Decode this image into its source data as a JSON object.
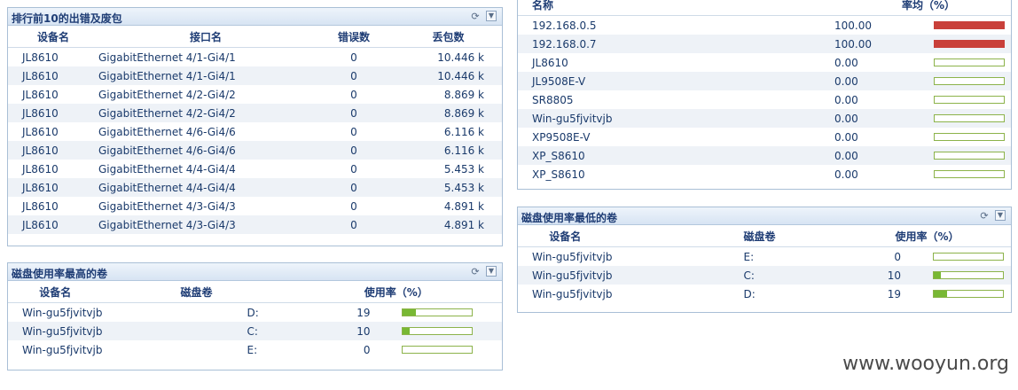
{
  "top_errors": {
    "title": "排行前10的出错及废包",
    "columns": [
      "设备名",
      "接口名",
      "错误数",
      "丢包数"
    ],
    "rows": [
      {
        "device": "JL8610",
        "iface": "GigabitEthernet 4/1-Gi4/1",
        "errors": "0",
        "drops": "10.446 k"
      },
      {
        "device": "JL8610",
        "iface": "GigabitEthernet 4/1-Gi4/1",
        "errors": "0",
        "drops": "10.446 k"
      },
      {
        "device": "JL8610",
        "iface": "GigabitEthernet 4/2-Gi4/2",
        "errors": "0",
        "drops": "8.869 k"
      },
      {
        "device": "JL8610",
        "iface": "GigabitEthernet 4/2-Gi4/2",
        "errors": "0",
        "drops": "8.869 k"
      },
      {
        "device": "JL8610",
        "iface": "GigabitEthernet 4/6-Gi4/6",
        "errors": "0",
        "drops": "6.116 k"
      },
      {
        "device": "JL8610",
        "iface": "GigabitEthernet 4/6-Gi4/6",
        "errors": "0",
        "drops": "6.116 k"
      },
      {
        "device": "JL8610",
        "iface": "GigabitEthernet 4/4-Gi4/4",
        "errors": "0",
        "drops": "5.453 k"
      },
      {
        "device": "JL8610",
        "iface": "GigabitEthernet 4/4-Gi4/4",
        "errors": "0",
        "drops": "5.453 k"
      },
      {
        "device": "JL8610",
        "iface": "GigabitEthernet 4/3-Gi4/3",
        "errors": "0",
        "drops": "4.891 k"
      },
      {
        "device": "JL8610",
        "iface": "GigabitEthernet 4/3-Gi4/3",
        "errors": "0",
        "drops": "4.891 k"
      }
    ]
  },
  "disk_highest": {
    "title": "磁盘使用率最高的卷",
    "columns": [
      "设备名",
      "磁盘卷",
      "使用率（%）"
    ],
    "rows": [
      {
        "device": "Win-gu5fjvitvjb",
        "volume": "D:",
        "usage": "19",
        "pct": 19
      },
      {
        "device": "Win-gu5fjvitvjb",
        "volume": "C:",
        "usage": "10",
        "pct": 10
      },
      {
        "device": "Win-gu5fjvitvjb",
        "volume": "E:",
        "usage": "0",
        "pct": 0
      }
    ]
  },
  "loss_rate": {
    "columns": [
      "名称",
      "率均（%）"
    ],
    "rows": [
      {
        "name": "192.168.0.5",
        "value": "100.00",
        "pct": 100
      },
      {
        "name": "192.168.0.7",
        "value": "100.00",
        "pct": 100
      },
      {
        "name": "JL8610",
        "value": "0.00",
        "pct": 0
      },
      {
        "name": "JL9508E-V",
        "value": "0.00",
        "pct": 0
      },
      {
        "name": "SR8805",
        "value": "0.00",
        "pct": 0
      },
      {
        "name": "Win-gu5fjvitvjb",
        "value": "0.00",
        "pct": 0
      },
      {
        "name": "XP9508E-V",
        "value": "0.00",
        "pct": 0
      },
      {
        "name": "XP_S8610",
        "value": "0.00",
        "pct": 0
      },
      {
        "name": "XP_S8610",
        "value": "0.00",
        "pct": 0
      }
    ]
  },
  "disk_lowest": {
    "title": "磁盘使用率最低的卷",
    "columns": [
      "设备名",
      "磁盘卷",
      "使用率（%）"
    ],
    "rows": [
      {
        "device": "Win-gu5fjvitvjb",
        "volume": "E:",
        "usage": "0",
        "pct": 0
      },
      {
        "device": "Win-gu5fjvitvjb",
        "volume": "C:",
        "usage": "10",
        "pct": 10
      },
      {
        "device": "Win-gu5fjvitvjb",
        "volume": "D:",
        "usage": "19",
        "pct": 19
      }
    ]
  },
  "icons": {
    "refresh": "refresh-icon",
    "dropdown": "chevron-down-icon"
  },
  "colors": {
    "bar_fill": "#78b833",
    "bar_alert": "#c9403a",
    "header": "#1f3d75"
  },
  "watermark": "www.wooyun.org"
}
